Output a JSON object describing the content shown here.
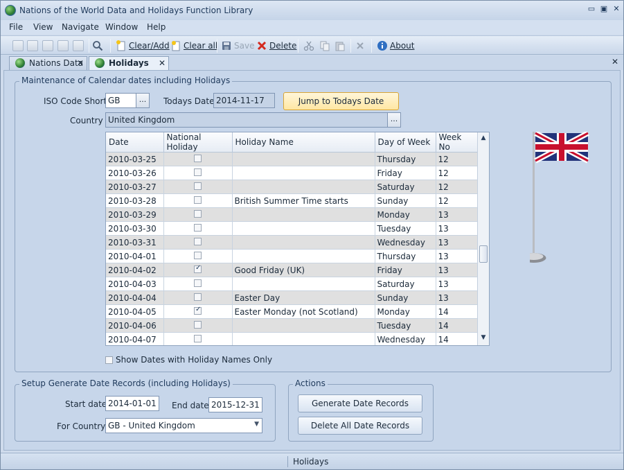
{
  "window": {
    "title": "Nations of the World Data and Holidays Function Library"
  },
  "menu": {
    "file": "File",
    "view": "View",
    "navigate": "Navigate",
    "window": "Window",
    "help": "Help"
  },
  "toolbar": {
    "clear_add": "Clear/Add",
    "clear_all": "Clear all",
    "save": "Save",
    "delete": "Delete",
    "about": "About"
  },
  "tabs": [
    {
      "label": "Nations Data"
    },
    {
      "label": "Holidays"
    }
  ],
  "maintenance": {
    "group_title": "Maintenance of Calendar dates including Holidays",
    "iso_label": "ISO Code Short",
    "iso_value": "GB",
    "todays_label": "Todays Date",
    "todays_value": "2014-11-17",
    "jump_button": "Jump to Todays Date",
    "country_label": "Country",
    "country_value": "United Kingdom",
    "ellipsis": "...",
    "show_only_label": "Show Dates with Holiday Names Only"
  },
  "grid": {
    "columns": [
      "Date",
      "National Holiday",
      "Holiday Name",
      "Day of Week",
      "Week No"
    ],
    "rows": [
      {
        "date": "2010-03-25",
        "holiday": false,
        "name": "",
        "dow": "Thursday",
        "week": "12"
      },
      {
        "date": "2010-03-26",
        "holiday": false,
        "name": "",
        "dow": "Friday",
        "week": "12"
      },
      {
        "date": "2010-03-27",
        "holiday": false,
        "name": "",
        "dow": "Saturday",
        "week": "12"
      },
      {
        "date": "2010-03-28",
        "holiday": false,
        "name": "British Summer Time starts",
        "dow": "Sunday",
        "week": "12"
      },
      {
        "date": "2010-03-29",
        "holiday": false,
        "name": "",
        "dow": "Monday",
        "week": "13"
      },
      {
        "date": "2010-03-30",
        "holiday": false,
        "name": "",
        "dow": "Tuesday",
        "week": "13"
      },
      {
        "date": "2010-03-31",
        "holiday": false,
        "name": "",
        "dow": "Wednesday",
        "week": "13"
      },
      {
        "date": "2010-04-01",
        "holiday": false,
        "name": "",
        "dow": "Thursday",
        "week": "13"
      },
      {
        "date": "2010-04-02",
        "holiday": true,
        "name": "Good Friday (UK)",
        "dow": "Friday",
        "week": "13"
      },
      {
        "date": "2010-04-03",
        "holiday": false,
        "name": "",
        "dow": "Saturday",
        "week": "13"
      },
      {
        "date": "2010-04-04",
        "holiday": false,
        "name": "Easter Day",
        "dow": "Sunday",
        "week": "13"
      },
      {
        "date": "2010-04-05",
        "holiday": true,
        "name": "Easter Monday (not Scotland)",
        "dow": "Monday",
        "week": "14"
      },
      {
        "date": "2010-04-06",
        "holiday": false,
        "name": "",
        "dow": "Tuesday",
        "week": "14"
      },
      {
        "date": "2010-04-07",
        "holiday": false,
        "name": "",
        "dow": "Wednesday",
        "week": "14"
      }
    ]
  },
  "setup": {
    "group_title": "Setup Generate Date Records (including Holidays)",
    "start_label": "Start date",
    "start_value": "2014-01-01",
    "end_label": "End date",
    "end_value": "2015-12-31",
    "country_label": "For Country",
    "country_value": "GB - United Kingdom"
  },
  "actions": {
    "group_title": "Actions",
    "generate": "Generate Date Records",
    "delete_all": "Delete All Date Records"
  },
  "status": {
    "text": "Holidays"
  }
}
